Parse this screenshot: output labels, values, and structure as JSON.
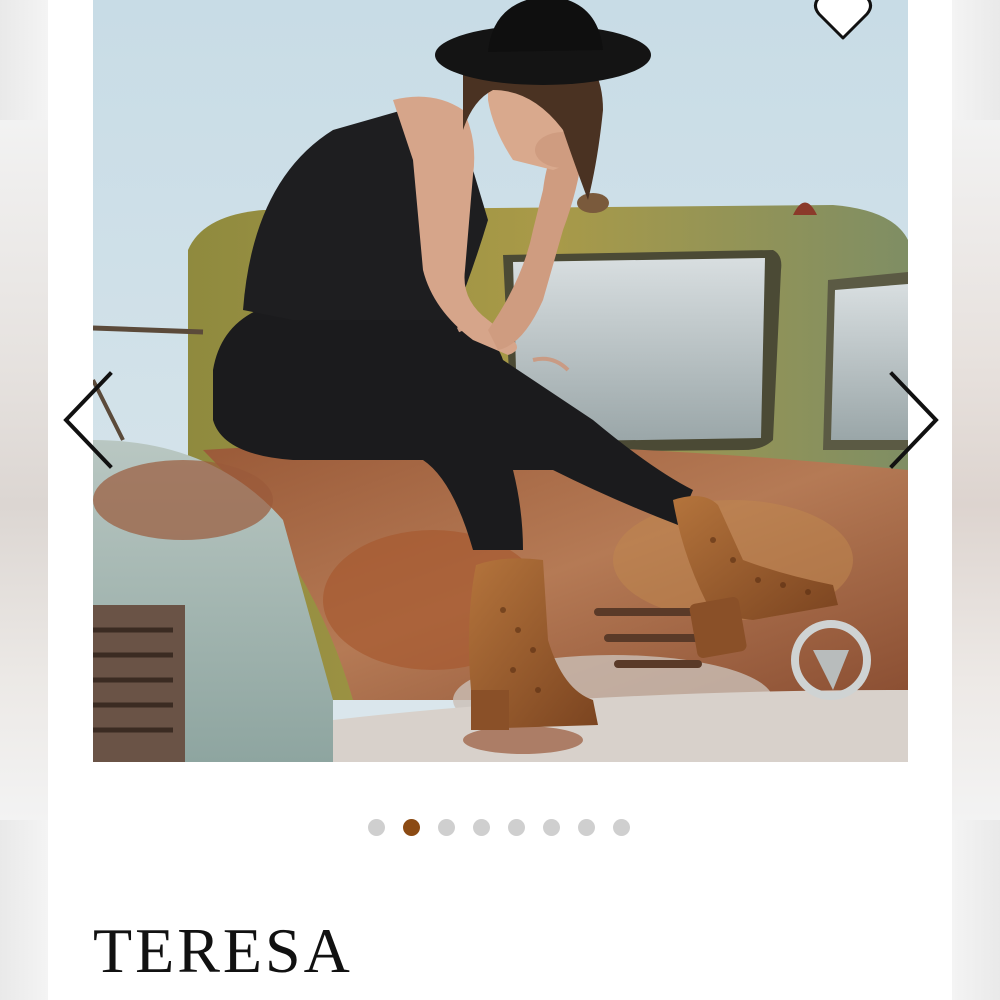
{
  "product": {
    "title": "TERESA"
  },
  "gallery": {
    "image_count": 8,
    "active_index": 1
  },
  "icons": {
    "favorite": "heart-outline-icon",
    "previous": "chevron-left-icon",
    "next": "chevron-right-icon"
  },
  "colors": {
    "active_dot": "#8b4a13",
    "inactive_dot": "#cfcfcf",
    "title_text": "#111111"
  }
}
